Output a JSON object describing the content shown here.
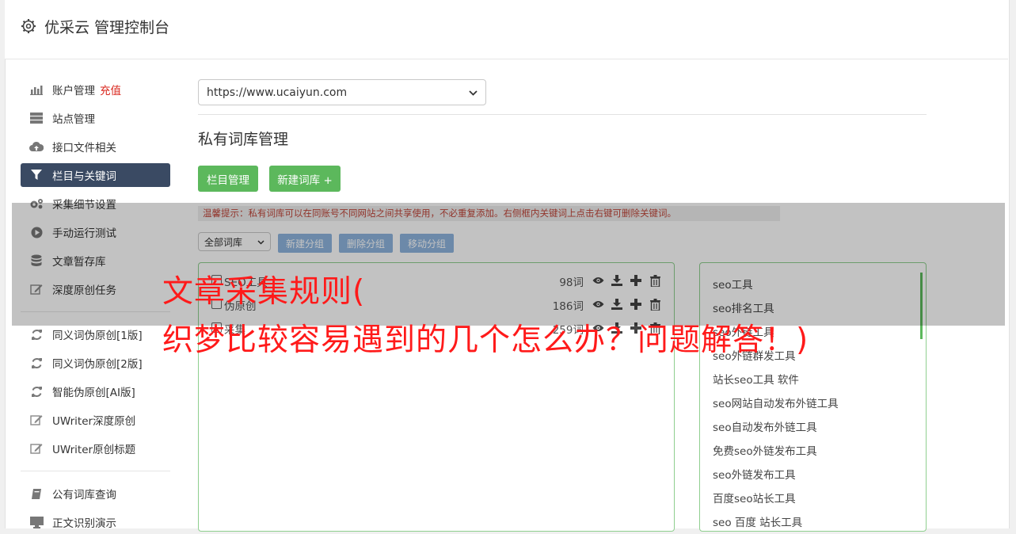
{
  "app": {
    "title": "优采云 管理控制台"
  },
  "sidebar": {
    "items": [
      {
        "label": "账户管理",
        "badge": "充值",
        "icon": "bar-chart-icon"
      },
      {
        "label": "站点管理",
        "icon": "server-icon"
      },
      {
        "label": "接口文件相关",
        "icon": "cloud-upload-icon"
      },
      {
        "label": "栏目与关键词",
        "icon": "filter-icon",
        "active": true
      },
      {
        "label": "采集细节设置",
        "icon": "cogs-icon"
      },
      {
        "label": "手动运行测试",
        "icon": "play-circle-icon"
      },
      {
        "label": "文章暂存库",
        "icon": "database-icon"
      },
      {
        "label": "深度原创任务",
        "icon": "edit-icon"
      },
      {
        "label": "同义词伪原创[1版]",
        "icon": "refresh-icon"
      },
      {
        "label": "同义词伪原创[2版]",
        "icon": "refresh-icon"
      },
      {
        "label": "智能伪原创[AI版]",
        "icon": "refresh-icon"
      },
      {
        "label": "UWriter深度原创",
        "icon": "edit-icon"
      },
      {
        "label": "UWriter原创标题",
        "icon": "edit-icon"
      },
      {
        "label": "公有词库查询",
        "icon": "book-icon"
      },
      {
        "label": "正文识别演示",
        "icon": "monitor-icon"
      }
    ]
  },
  "main": {
    "site_select": "https://www.ucaiyun.com",
    "section_title": "私有词库管理",
    "btn_column": "栏目管理",
    "btn_new_lib": "新建词库 +",
    "tip": "温馨提示：私有词库可以在同账号不同网站之间共享使用，不必重复添加。右侧框内关键词上点击右键可删除关键词。",
    "lib_select": "全部词库",
    "btn_new_group": "新建分组",
    "btn_del_group": "删除分组",
    "btn_move_group": "移动分组",
    "libraries": [
      {
        "name": "SEO工具",
        "count": "98词"
      },
      {
        "name": "伪原创",
        "count": "186词"
      },
      {
        "name": "采集",
        "count": "259词"
      }
    ],
    "keywords": [
      "seo工具",
      "seo排名工具",
      "seo外链工具",
      "seo外链群发工具",
      "站长seo工具 软件",
      "seo网站自动发布外链工具",
      "seo自动发布外链工具",
      "免费seo外链发布工具",
      "seo外链发布工具",
      "百度seo站长工具",
      "seo 百度 站长工具"
    ]
  },
  "overlay": {
    "line1": "文章采集规则(",
    "line2": "织梦比较容易遇到的几个怎么办？问题解答！)"
  },
  "colors": {
    "accent_green": "#5cb85c",
    "active_nav": "#3a4a63",
    "overlay_text": "#ff1a1a",
    "badge_red": "#d9261c"
  }
}
